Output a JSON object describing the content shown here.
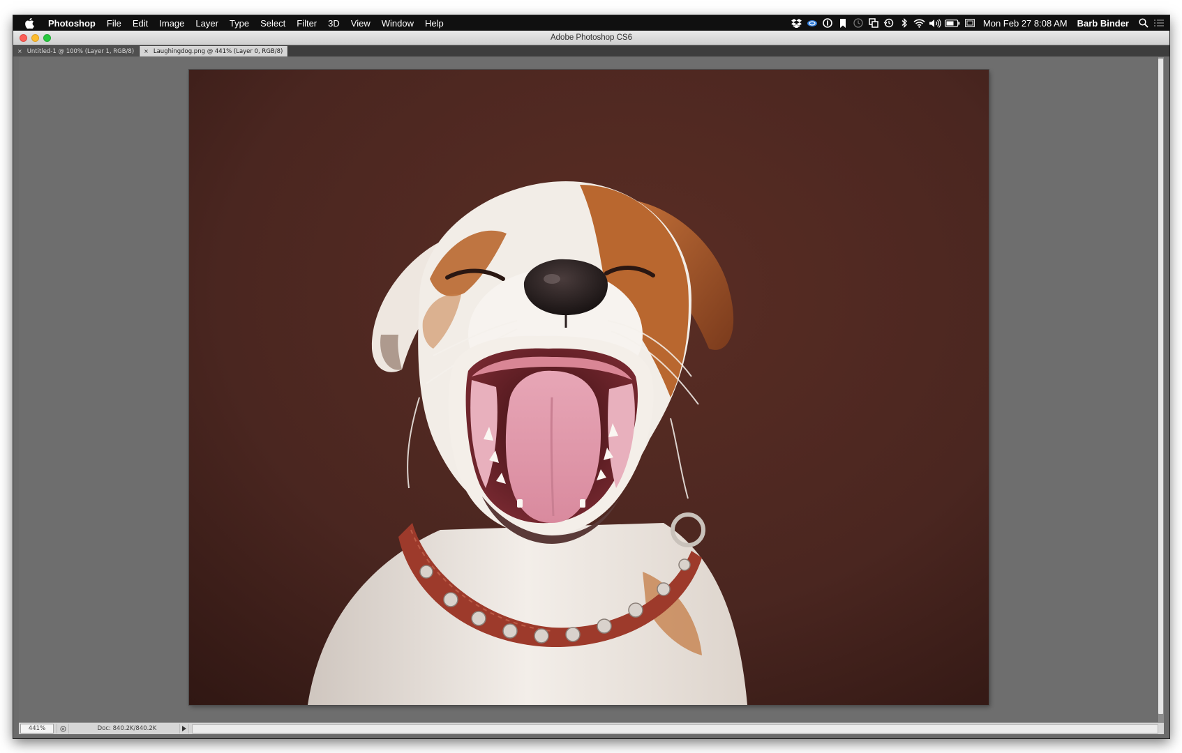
{
  "menubar": {
    "app_name": "Photoshop",
    "menus": [
      "File",
      "Edit",
      "Image",
      "Layer",
      "Type",
      "Select",
      "Filter",
      "3D",
      "View",
      "Window",
      "Help"
    ],
    "status_icons": [
      "dropbox-icon",
      "creative-cloud-icon",
      "1password-icon",
      "bookmark-icon",
      "clock-icon",
      "screen-mirror-icon",
      "time-machine-icon",
      "bluetooth-icon",
      "wifi-icon",
      "volume-icon",
      "battery-icon",
      "input-source-icon"
    ],
    "clock": "Mon Feb 27  8:08 AM",
    "user": "Barb Binder"
  },
  "window": {
    "title": "Adobe Photoshop CS6"
  },
  "tabs": [
    {
      "label": "Untitled-1 @ 100% (Layer 1, RGB/8)",
      "active": false
    },
    {
      "label": "Laughingdog.png @ 441% (Layer 0, RGB/8)",
      "active": true
    }
  ],
  "document": {
    "image_subject": "laughing-dog-photo"
  },
  "statusbar": {
    "zoom": "441%",
    "doc_size": "Doc: 840.2K/840.2K"
  },
  "colors": {
    "menubar_bg": "#101010",
    "canvas_bg": "#6e6e6e",
    "photo_background": "#4a2620",
    "dog_white": "#f1ece6",
    "dog_tan": "#b4622b",
    "collar": "#9d3a2b",
    "tongue": "#e49aac"
  }
}
